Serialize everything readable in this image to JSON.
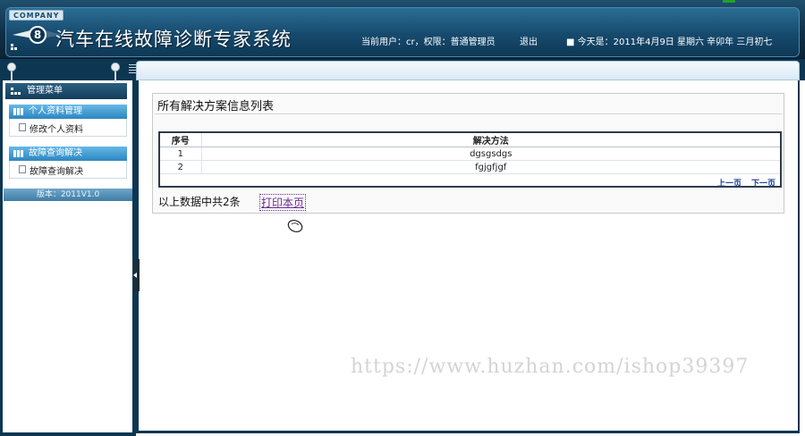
{
  "header": {
    "company": "COMPANY",
    "title": "汽车在线故障诊断专家系统",
    "user_info": "当前用户：cr，权限：普通管理员",
    "logout": "退出",
    "today": "■ 今天是：2011年4月9日 星期六 辛卯年 三月初七"
  },
  "sidebar": {
    "menu_title": "管理菜单",
    "groups": [
      {
        "label": "个人资料管理",
        "items": [
          {
            "label": "修改个人资料"
          }
        ]
      },
      {
        "label": "故障查询解决",
        "items": [
          {
            "label": "故障查询解决"
          }
        ]
      }
    ],
    "version": "版本：2011V1.0"
  },
  "main": {
    "list_title": "所有解决方案信息列表",
    "table": {
      "columns": [
        "序号",
        "解决方法"
      ],
      "rows": [
        [
          "1",
          "dgsgsdgs"
        ],
        [
          "2",
          "fgjgfjgf"
        ]
      ]
    },
    "pager": {
      "prev": "上一页",
      "next": "下一页"
    },
    "summary": "以上数据中共2条",
    "print_link": "打印本页"
  },
  "watermark": "https://www.huzhan.com/ishop39397",
  "colors": {
    "header_dark": "#0d3652",
    "accent_blue": "#2d86c0",
    "link_purple": "#6a2a8f",
    "pager_blue": "#1b3d9a"
  }
}
